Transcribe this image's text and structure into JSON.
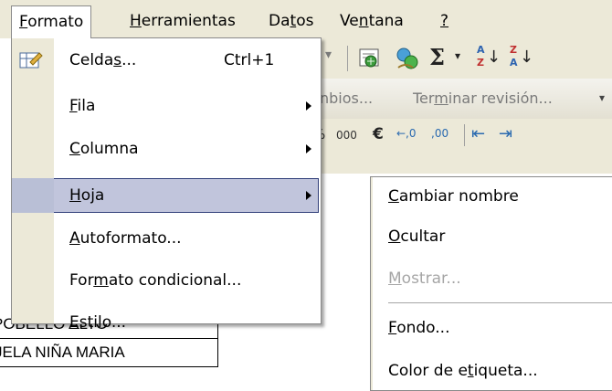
{
  "menubar": {
    "items": [
      {
        "pre": "",
        "key": "F",
        "post": "ormato"
      },
      {
        "pre": "",
        "key": "H",
        "post": "erramientas"
      },
      {
        "pre": "Da",
        "key": "t",
        "post": "os"
      },
      {
        "pre": "Ve",
        "key": "n",
        "post": "tana"
      },
      {
        "pre": "",
        "key": "?",
        "post": ""
      }
    ]
  },
  "toolbar": {
    "icons": [
      "dropdown-arrow-icon",
      "insert-hyperlink-icon",
      "research-icon",
      "autosum-icon",
      "sort-ascending-icon",
      "sort-descending-icon"
    ],
    "review": {
      "cambios": "nbios...",
      "terminar_pre": "Ter",
      "terminar_key": "m",
      "terminar_post": "inar revisión..."
    },
    "format_glyphs": {
      "percent": "%",
      "thousands": "000",
      "euro": "€",
      "inc_decimal": "←,0",
      "dec_decimal": ",00",
      "indent_left": "⇤",
      "indent_right": "⇥"
    }
  },
  "format_menu": {
    "items": [
      {
        "pre": "Celda",
        "key": "s",
        "post": "...",
        "shortcut": "Ctrl+1",
        "submenu": false,
        "icon": "format-cells-icon"
      },
      {
        "pre": "",
        "key": "F",
        "post": "ila",
        "shortcut": "",
        "submenu": true
      },
      {
        "pre": "",
        "key": "C",
        "post": "olumna",
        "shortcut": "",
        "submenu": true
      },
      {
        "pre": "",
        "key": "H",
        "post": "oja",
        "shortcut": "",
        "submenu": true,
        "selected": true
      },
      {
        "pre": "",
        "key": "A",
        "post": "utoformato...",
        "shortcut": "",
        "submenu": false
      },
      {
        "pre": "For",
        "key": "m",
        "post": "ato condicional...",
        "shortcut": "",
        "submenu": false
      },
      {
        "pre": "",
        "key": "E",
        "post": "stilo...",
        "shortcut": "",
        "submenu": false
      }
    ]
  },
  "hoja_submenu": {
    "items": [
      {
        "pre": "",
        "key": "C",
        "post": "ambiar nombre",
        "disabled": false
      },
      {
        "pre": "",
        "key": "O",
        "post": "cultar",
        "disabled": false
      },
      {
        "pre": "",
        "key": "M",
        "post": "ostrar...",
        "disabled": true
      },
      {
        "pre": "",
        "key": "F",
        "post": "ondo...",
        "disabled": false
      },
      {
        "pre": "Color de e",
        "key": "t",
        "post": "iqueta...",
        "disabled": false
      }
    ]
  },
  "sheet": {
    "cells": [
      "POBELLO ALTO",
      "JELA NIÑA MARIA"
    ]
  },
  "colors": {
    "menubar_bg": "#ece9d8",
    "selection_bg": "#c1c5dc",
    "selection_border": "#33417b",
    "disabled_text": "#a6a6a6"
  }
}
